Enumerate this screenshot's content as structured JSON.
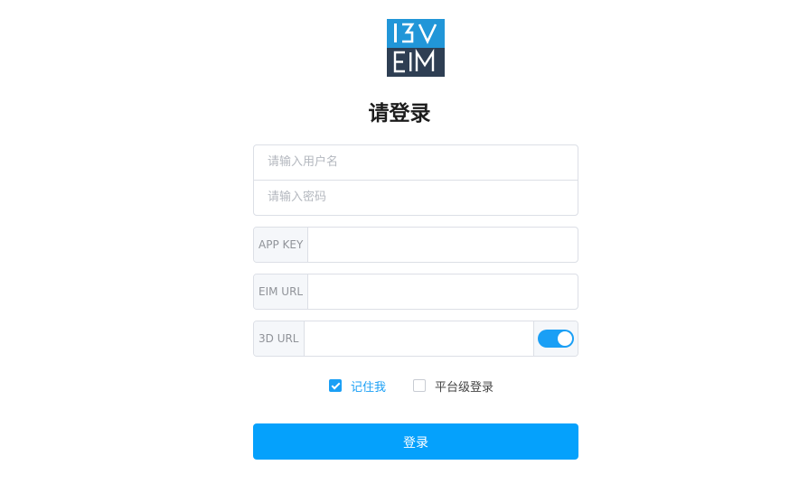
{
  "logo": {
    "top_text": "I3V",
    "bottom_text": "EIM",
    "top_color": "#2196d8",
    "bottom_color": "#2e3e53"
  },
  "title": "请登录",
  "username": {
    "placeholder": "请输入用户名"
  },
  "password": {
    "placeholder": "请输入密码"
  },
  "app_key": {
    "label": "APP KEY",
    "value": ""
  },
  "eim_url": {
    "label": "EIM URL",
    "value": ""
  },
  "url_3d": {
    "label": "3D URL",
    "value": "",
    "toggle_on": true
  },
  "remember_me": {
    "label": "记住我",
    "checked": true
  },
  "platform_login": {
    "label": "平台级登录",
    "checked": false
  },
  "submit": {
    "label": "登录"
  },
  "colors": {
    "accent": "#05a1fc",
    "border": "#dcdfe6",
    "addon_bg": "#f5f7fa"
  }
}
